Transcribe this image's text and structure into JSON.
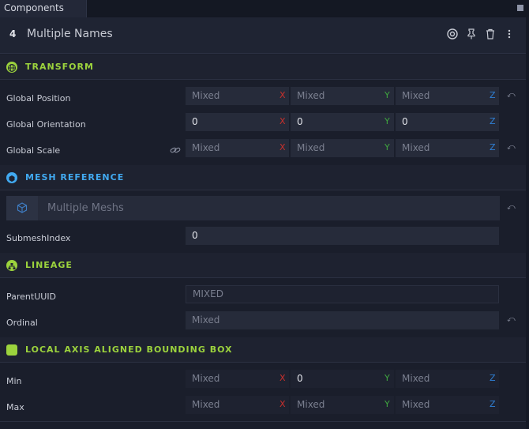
{
  "tab": {
    "label": "Components"
  },
  "header": {
    "count": "4",
    "title": "Multiple Names"
  },
  "sections": {
    "transform": {
      "title": "TRANSFORM"
    },
    "mesh": {
      "title": "MESH REFERENCE"
    },
    "lineage": {
      "title": "LINEAGE"
    },
    "aabb": {
      "title": "LOCAL AXIS ALIGNED BOUNDING BOX"
    }
  },
  "axis": {
    "x": "X",
    "y": "Y",
    "z": "Z"
  },
  "rows": {
    "global_position": {
      "label": "Global Position",
      "x": "Mixed",
      "y": "Mixed",
      "z": "Mixed"
    },
    "global_orientation": {
      "label": "Global Orientation",
      "x": "0",
      "y": "0",
      "z": "0"
    },
    "global_scale": {
      "label": "Global Scale",
      "x": "Mixed",
      "y": "Mixed",
      "z": "Mixed"
    },
    "mesh_picker": {
      "value": "Multiple Meshs"
    },
    "submesh_index": {
      "label": "SubmeshIndex",
      "value": "0"
    },
    "parent_uuid": {
      "label": "ParentUUID",
      "value": "MIXED"
    },
    "ordinal": {
      "label": "Ordinal",
      "value": "Mixed"
    },
    "min": {
      "label": "Min",
      "x": "Mixed",
      "y": "0",
      "z": "Mixed"
    },
    "max": {
      "label": "Max",
      "x": "Mixed",
      "y": "Mixed",
      "z": "Mixed"
    }
  },
  "icons": [
    "target-icon",
    "pin-icon",
    "trash-icon",
    "more-icon",
    "globe-icon",
    "cube-icon",
    "hierarchy-icon",
    "square-icon",
    "link-icon",
    "reset-icon"
  ],
  "colors": {
    "accent_green": "#9cd33d",
    "accent_blue": "#41a9f0",
    "axis_x": "#c9302c",
    "axis_y": "#3fa53f",
    "axis_z": "#2f80d6"
  }
}
